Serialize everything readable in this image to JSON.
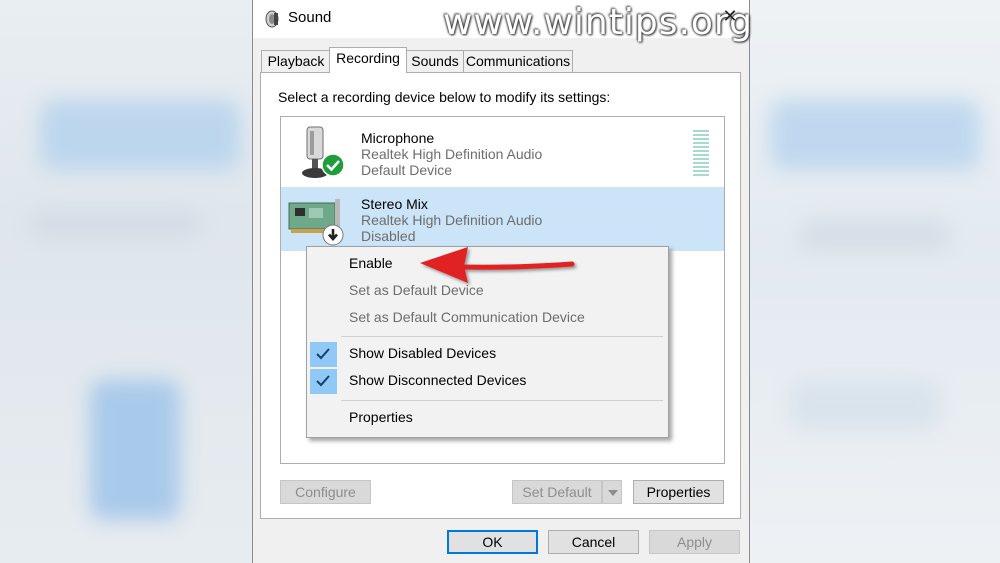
{
  "dialog": {
    "title": "Sound",
    "watermark": "www.wintips.org",
    "tabs": [
      "Playback",
      "Recording",
      "Sounds",
      "Communications"
    ],
    "active_tab": "Recording",
    "instruction": "Select a recording device below to modify its settings:",
    "devices": [
      {
        "name": "Microphone",
        "driver": "Realtek High Definition Audio",
        "status": "Default Device",
        "status_icon": "green-check"
      },
      {
        "name": "Stereo Mix",
        "driver": "Realtek High Definition Audio",
        "status": "Disabled",
        "status_icon": "down-arrow"
      }
    ],
    "buttons": {
      "configure": "Configure",
      "set_default": "Set Default",
      "properties": "Properties",
      "ok": "OK",
      "cancel": "Cancel",
      "apply": "Apply"
    }
  },
  "context_menu": {
    "enable": "Enable",
    "set_default_device": "Set as Default Device",
    "set_default_comm": "Set as Default Communication Device",
    "show_disabled": "Show Disabled Devices",
    "show_disconnected": "Show Disconnected Devices",
    "properties": "Properties"
  },
  "colors": {
    "selection": "#cce4f7",
    "check_highlight": "#90c8f6",
    "annotation_arrow": "#e02020"
  }
}
